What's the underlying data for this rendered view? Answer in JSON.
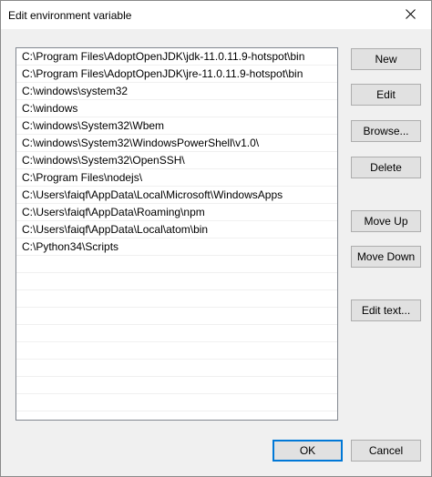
{
  "window": {
    "title": "Edit environment variable"
  },
  "paths": [
    "C:\\Program Files\\AdoptOpenJDK\\jdk-11.0.11.9-hotspot\\bin",
    "C:\\Program Files\\AdoptOpenJDK\\jre-11.0.11.9-hotspot\\bin",
    "C:\\windows\\system32",
    "C:\\windows",
    "C:\\windows\\System32\\Wbem",
    "C:\\windows\\System32\\WindowsPowerShell\\v1.0\\",
    "C:\\windows\\System32\\OpenSSH\\",
    "C:\\Program Files\\nodejs\\",
    "C:\\Users\\faiqf\\AppData\\Local\\Microsoft\\WindowsApps",
    "C:\\Users\\faiqf\\AppData\\Roaming\\npm",
    "C:\\Users\\faiqf\\AppData\\Local\\atom\\bin",
    "C:\\Python34\\Scripts",
    "",
    "",
    "",
    "",
    "",
    "",
    "",
    "",
    ""
  ],
  "buttons": {
    "new": "New",
    "edit": "Edit",
    "browse": "Browse...",
    "delete": "Delete",
    "move_up": "Move Up",
    "move_down": "Move Down",
    "edit_text": "Edit text...",
    "ok": "OK",
    "cancel": "Cancel"
  },
  "icons": {
    "close": "close-icon"
  }
}
